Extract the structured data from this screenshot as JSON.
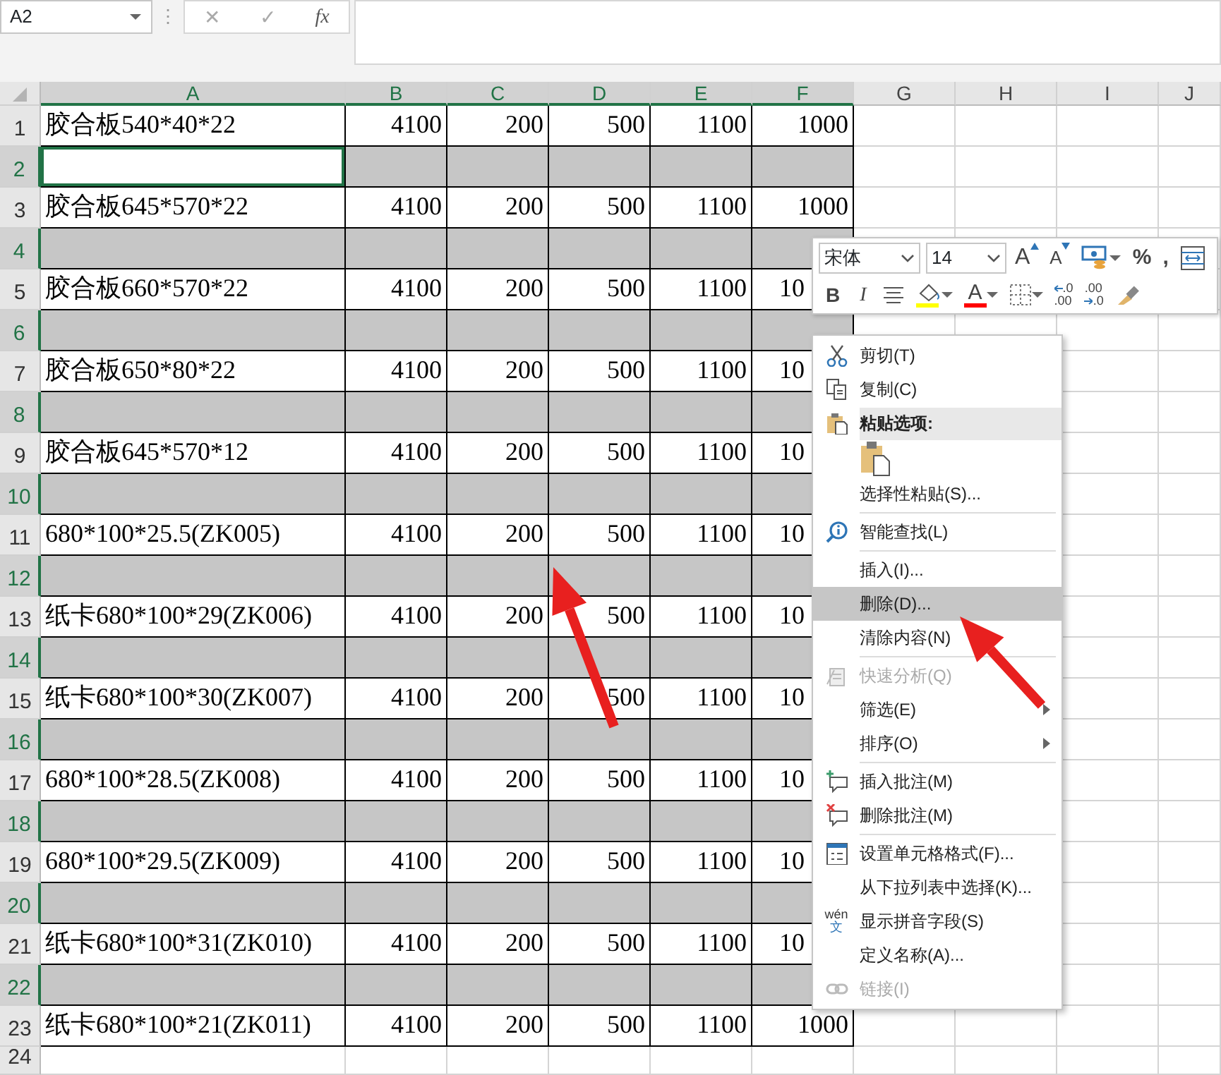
{
  "formula_bar": {
    "name_box": "A2",
    "divider": "⋮",
    "cancel": "✕",
    "enter": "✓",
    "function": "fx"
  },
  "columns": [
    {
      "label": "A",
      "selected": true
    },
    {
      "label": "B",
      "selected": true
    },
    {
      "label": "C",
      "selected": true
    },
    {
      "label": "D",
      "selected": true
    },
    {
      "label": "E",
      "selected": true
    },
    {
      "label": "F",
      "selected": true
    },
    {
      "label": "G",
      "selected": false
    },
    {
      "label": "H",
      "selected": false
    },
    {
      "label": "I",
      "selected": false
    },
    {
      "label": "J",
      "selected": false
    }
  ],
  "rows": [
    {
      "header": "1",
      "selected": false,
      "cells": [
        {
          "text": "胶合板540*40*22"
        },
        {
          "text": "4100"
        },
        {
          "text": "200"
        },
        {
          "text": "500"
        },
        {
          "text": "1100"
        },
        {
          "text": "1000"
        }
      ]
    },
    {
      "header": "2",
      "selected": true,
      "active": true
    },
    {
      "header": "3",
      "selected": false,
      "cells": [
        {
          "text": "胶合板645*570*22"
        },
        {
          "text": "4100"
        },
        {
          "text": "200"
        },
        {
          "text": "500"
        },
        {
          "text": "1100"
        },
        {
          "text": "1000"
        }
      ]
    },
    {
      "header": "4",
      "selected": true
    },
    {
      "header": "5",
      "selected": false,
      "cells": [
        {
          "text": "胶合板660*570*22"
        },
        {
          "text": "4100"
        },
        {
          "text": "200"
        },
        {
          "text": "500"
        },
        {
          "text": "1100"
        },
        {
          "text": "10",
          "cut": true
        }
      ]
    },
    {
      "header": "6",
      "selected": true
    },
    {
      "header": "7",
      "selected": false,
      "cells": [
        {
          "text": "胶合板650*80*22"
        },
        {
          "text": "4100"
        },
        {
          "text": "200"
        },
        {
          "text": "500"
        },
        {
          "text": "1100"
        },
        {
          "text": "10",
          "cut": true
        }
      ]
    },
    {
      "header": "8",
      "selected": true
    },
    {
      "header": "9",
      "selected": false,
      "cells": [
        {
          "text": "胶合板645*570*12"
        },
        {
          "text": "4100"
        },
        {
          "text": "200"
        },
        {
          "text": "500"
        },
        {
          "text": "1100"
        },
        {
          "text": "10",
          "cut": true
        }
      ]
    },
    {
      "header": "10",
      "selected": true
    },
    {
      "header": "11",
      "selected": false,
      "cells": [
        {
          "text": "680*100*25.5(ZK005)"
        },
        {
          "text": "4100"
        },
        {
          "text": "200"
        },
        {
          "text": "500"
        },
        {
          "text": "1100"
        },
        {
          "text": "10",
          "cut": true
        }
      ]
    },
    {
      "header": "12",
      "selected": true
    },
    {
      "header": "13",
      "selected": false,
      "cells": [
        {
          "text": "纸卡680*100*29(ZK006)"
        },
        {
          "text": "4100"
        },
        {
          "text": "200"
        },
        {
          "text": "500"
        },
        {
          "text": "1100"
        },
        {
          "text": "10",
          "cut": true
        }
      ]
    },
    {
      "header": "14",
      "selected": true
    },
    {
      "header": "15",
      "selected": false,
      "cells": [
        {
          "text": "纸卡680*100*30(ZK007)"
        },
        {
          "text": "4100"
        },
        {
          "text": "200"
        },
        {
          "text": "500"
        },
        {
          "text": "1100"
        },
        {
          "text": "10",
          "cut": true
        }
      ]
    },
    {
      "header": "16",
      "selected": true
    },
    {
      "header": "17",
      "selected": false,
      "cells": [
        {
          "text": "680*100*28.5(ZK008)"
        },
        {
          "text": "4100"
        },
        {
          "text": "200"
        },
        {
          "text": "500"
        },
        {
          "text": "1100"
        },
        {
          "text": "10",
          "cut": true
        }
      ]
    },
    {
      "header": "18",
      "selected": true
    },
    {
      "header": "19",
      "selected": false,
      "cells": [
        {
          "text": "680*100*29.5(ZK009)"
        },
        {
          "text": "4100"
        },
        {
          "text": "200"
        },
        {
          "text": "500"
        },
        {
          "text": "1100"
        },
        {
          "text": "10",
          "cut": true
        }
      ]
    },
    {
      "header": "20",
      "selected": true
    },
    {
      "header": "21",
      "selected": false,
      "cells": [
        {
          "text": "纸卡680*100*31(ZK010)"
        },
        {
          "text": "4100"
        },
        {
          "text": "200"
        },
        {
          "text": "500"
        },
        {
          "text": "1100"
        },
        {
          "text": "10",
          "cut": true
        }
      ]
    },
    {
      "header": "22",
      "selected": true
    },
    {
      "header": "23",
      "selected": false,
      "cells": [
        {
          "text": "纸卡680*100*21(ZK011)"
        },
        {
          "text": "4100"
        },
        {
          "text": "200"
        },
        {
          "text": "500"
        },
        {
          "text": "1100"
        },
        {
          "text": "1000"
        }
      ]
    },
    {
      "header": "24",
      "selected": false
    }
  ],
  "mini_toolbar": {
    "font": "宋体",
    "size": "14",
    "row_1": [
      {
        "kind": "grow",
        "label": "A"
      },
      {
        "kind": "shrink",
        "label": "A"
      },
      {
        "kind": "accounting"
      },
      {
        "kind": "text",
        "label": "%"
      },
      {
        "kind": "text",
        "label": ","
      },
      {
        "kind": "wrap"
      }
    ],
    "row_2": [
      {
        "kind": "bold",
        "label": "B"
      },
      {
        "kind": "italic",
        "label": "I"
      },
      {
        "kind": "align"
      },
      {
        "kind": "fill",
        "color": "#ffff00"
      },
      {
        "kind": "font-color",
        "label": "A",
        "color": "#ff0000"
      },
      {
        "kind": "borders"
      },
      {
        "kind": "decimal",
        "lines": [
          ".0",
          ".00"
        ]
      },
      {
        "kind": "decimal",
        "lines": [
          ".00",
          ".0"
        ]
      },
      {
        "kind": "painter"
      }
    ]
  },
  "context_menu": [
    {
      "kind": "item",
      "label": "剪切(T)",
      "selected": false,
      "disabled": false
    },
    {
      "kind": "item",
      "label": "复制(C)",
      "selected": false,
      "disabled": false
    },
    {
      "kind": "header",
      "label": "粘贴选项:"
    },
    {
      "kind": "paste-options"
    },
    {
      "kind": "item",
      "label": "选择性粘贴(S)...",
      "selected": false,
      "disabled": false
    },
    {
      "kind": "separator"
    },
    {
      "kind": "item",
      "label": "智能查找(L)",
      "selected": false,
      "disabled": false
    },
    {
      "kind": "separator"
    },
    {
      "kind": "item",
      "label": "插入(I)...",
      "selected": false,
      "disabled": false
    },
    {
      "kind": "item",
      "label": "删除(D)...",
      "selected": true,
      "disabled": false
    },
    {
      "kind": "item",
      "label": "清除内容(N)",
      "selected": false,
      "disabled": false
    },
    {
      "kind": "separator"
    },
    {
      "kind": "item",
      "label": "快速分析(Q)",
      "selected": false,
      "disabled": true
    },
    {
      "kind": "item",
      "label": "筛选(E)",
      "selected": false,
      "disabled": false,
      "submenu": true
    },
    {
      "kind": "item",
      "label": "排序(O)",
      "selected": false,
      "disabled": false,
      "submenu": true
    },
    {
      "kind": "separator"
    },
    {
      "kind": "item",
      "label": "插入批注(M)",
      "selected": false,
      "disabled": false
    },
    {
      "kind": "item",
      "label": "删除批注(M)",
      "selected": false,
      "disabled": false
    },
    {
      "kind": "separator"
    },
    {
      "kind": "item",
      "label": "设置单元格格式(F)...",
      "selected": false,
      "disabled": false
    },
    {
      "kind": "item",
      "label": "从下拉列表中选择(K)...",
      "selected": false,
      "disabled": false
    },
    {
      "kind": "item",
      "label": "显示拼音字段(S)",
      "selected": false,
      "disabled": false,
      "icon_text": [
        "wén",
        "文"
      ]
    },
    {
      "kind": "item",
      "label": "定义名称(A)...",
      "selected": false,
      "disabled": false
    },
    {
      "kind": "item",
      "label": "链接(I)",
      "selected": false,
      "disabled": true
    }
  ]
}
